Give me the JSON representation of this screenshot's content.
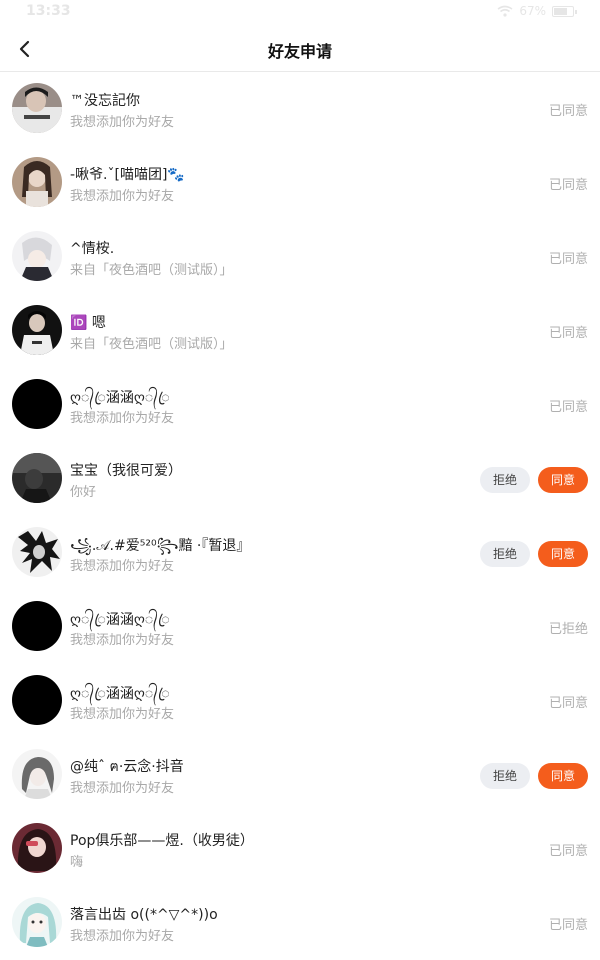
{
  "status_bar": {
    "time": "13:33",
    "battery": "67%",
    "battery_level": 0.67
  },
  "header": {
    "title": "好友申请"
  },
  "requests": [
    {
      "name": "™没忘記你",
      "message": "我想添加你为好友",
      "status": "已同意"
    },
    {
      "name": "-啾爷.ˇ[喵喵团]🐾",
      "message": "我想添加你为好友",
      "status": "已同意"
    },
    {
      "name": "^情桉.",
      "message": "来自「夜色酒吧（测试版）」",
      "status": "已同意"
    },
    {
      "name": "🆔 嗯",
      "message": "来自「夜色酒吧（测试版）」",
      "status": "已同意"
    },
    {
      "name": "ღ᭄ꦿ涵涵ღ᭄ꦿ",
      "message": "我想添加你为好友",
      "status": "已同意"
    },
    {
      "name": "宝宝（我很可爱）",
      "message": "你好",
      "reject_label": "拒绝",
      "accept_label": "同意"
    },
    {
      "name": "꧁.𝒜.#爱⁵²⁰꧂黯 ·『暂退』",
      "message": "我想添加你为好友",
      "reject_label": "拒绝",
      "accept_label": "同意"
    },
    {
      "name": "ღ᭄ꦿ涵涵ღ᭄ꦿ",
      "message": "我想添加你为好友",
      "status": "已拒绝"
    },
    {
      "name": "ღ᭄ꦿ涵涵ღ᭄ꦿ",
      "message": "我想添加你为好友",
      "status": "已同意"
    },
    {
      "name": "@纯ˆ ฅ·云念·抖音",
      "message": "我想添加你为好友",
      "reject_label": "拒绝",
      "accept_label": "同意"
    },
    {
      "name": "Pop俱乐部——煜.（收男徒）",
      "message": "嗨",
      "status": "已同意"
    },
    {
      "name": "落言出齿 o((*^▽^*))o",
      "message": "我想添加你为好友",
      "status": "已同意"
    }
  ],
  "colors": {
    "accent": "#f45d1c",
    "muted": "#a9a9a9",
    "reject_bg": "#eceef2"
  }
}
